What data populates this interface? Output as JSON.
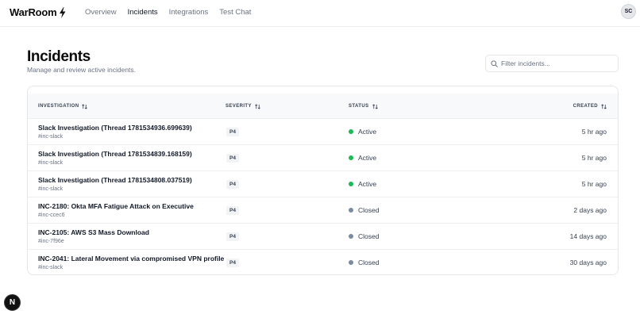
{
  "app": {
    "brand": "WarRoom"
  },
  "nav": {
    "items": [
      {
        "label": "Overview"
      },
      {
        "label": "Incidents"
      },
      {
        "label": "Integrations"
      },
      {
        "label": "Test Chat"
      }
    ],
    "active": "Incidents"
  },
  "user": {
    "initials": "SC"
  },
  "page": {
    "title": "Incidents",
    "subtitle": "Manage and review active incidents."
  },
  "search": {
    "placeholder": "Filter incidents...",
    "value": ""
  },
  "table": {
    "columns": {
      "investigation": "INVESTIGATION",
      "severity": "SEVERITY",
      "status": "STATUS",
      "created": "CREATED"
    },
    "rows": [
      {
        "title": "Slack Investigation (Thread 1781534936.699639)",
        "channel": "#inc-slack",
        "severity": "P4",
        "status": "Active",
        "created": "5 hr ago"
      },
      {
        "title": "Slack Investigation (Thread 1781534839.168159)",
        "channel": "#inc-slack",
        "severity": "P4",
        "status": "Active",
        "created": "5 hr ago"
      },
      {
        "title": "Slack Investigation (Thread 1781534808.037519)",
        "channel": "#inc-slack",
        "severity": "P4",
        "status": "Active",
        "created": "5 hr ago"
      },
      {
        "title": "INC-2180: Okta MFA Fatigue Attack on Executive",
        "channel": "#inc-ccec6",
        "severity": "P4",
        "status": "Closed",
        "created": "2 days ago"
      },
      {
        "title": "INC-2105: AWS S3 Mass Download",
        "channel": "#inc-7f96e",
        "severity": "P4",
        "status": "Closed",
        "created": "14 days ago"
      },
      {
        "title": "INC-2041: Lateral Movement via compromised VPN profile",
        "channel": "#inc-slack",
        "severity": "P4",
        "status": "Closed",
        "created": "30 days ago"
      }
    ]
  },
  "status_colors": {
    "Active": "#1db954",
    "Closed": "#7c8aa0"
  },
  "fab": {
    "label": "N"
  }
}
